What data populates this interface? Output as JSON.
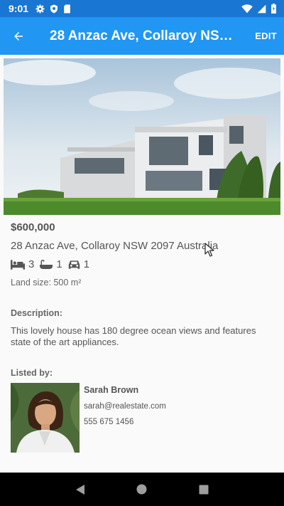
{
  "status_bar": {
    "time": "9:01"
  },
  "app_bar": {
    "title": "28 Anzac Ave, Collaroy NSW 2097 Australia",
    "edit_label": "EDIT"
  },
  "listing": {
    "price": "$600,000",
    "address": "28 Anzac Ave, Collaroy NSW 2097 Australia",
    "beds": "3",
    "baths": "1",
    "cars": "1",
    "land_size": "Land size: 500 m²",
    "description_label": "Description:",
    "description": "This lovely house has 180 degree ocean views and features state of the art appliances."
  },
  "agent": {
    "label": "Listed by:",
    "name": "Sarah Brown",
    "email": "sarah@realestate.com",
    "phone": "555 675 1456"
  },
  "colors": {
    "status_bar": "#1976d2",
    "app_bar": "#2196f3",
    "nav_bar": "#000000"
  }
}
